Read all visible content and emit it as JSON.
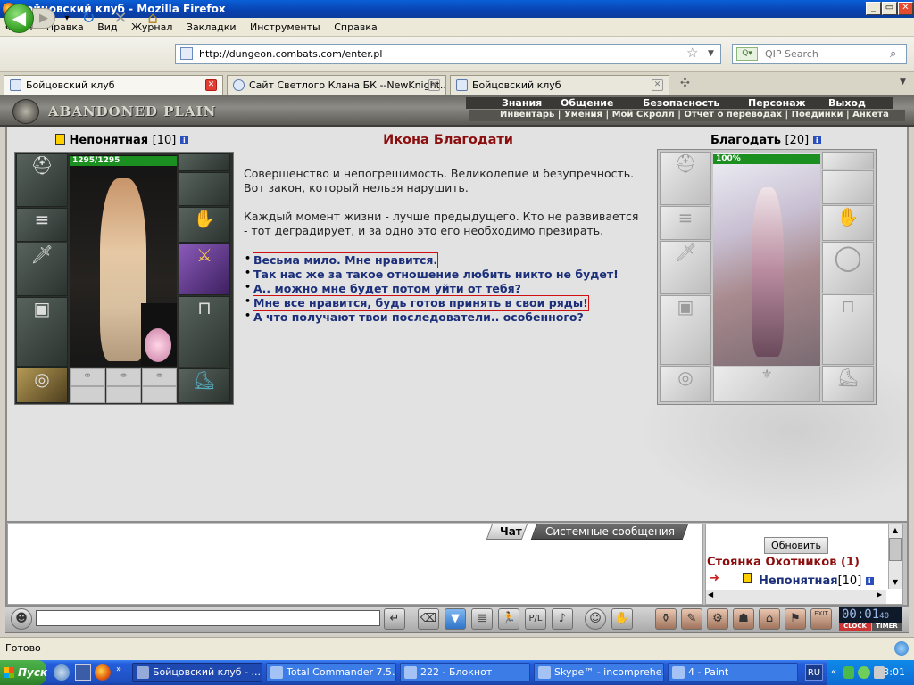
{
  "window": {
    "title": "Бойцовский клуб - Mozilla Firefox"
  },
  "menu": [
    "Файл",
    "Правка",
    "Вид",
    "Журнал",
    "Закладки",
    "Инструменты",
    "Справка"
  ],
  "toolbar": {
    "url": "http://dungeon.combats.com/enter.pl",
    "search_placeholder": "QIP Search"
  },
  "tabs": [
    {
      "label": "Бойцовский клуб",
      "active": true
    },
    {
      "label": "Сайт Светлого Клана БК --NewKnight...",
      "active": false
    },
    {
      "label": "Бойцовский клуб",
      "active": false
    }
  ],
  "game": {
    "location_logo": "ABANDONED PLAIN",
    "top_nav": [
      "Знания",
      "Общение",
      "Безопасность",
      "Персонаж",
      "Выход"
    ],
    "sub_nav": [
      "Инвентарь",
      "Умения",
      "Мой Скролл",
      "Отчет о переводах",
      "Поединки",
      "Анкета"
    ],
    "player": {
      "name": "Непонятная",
      "level": "[10]",
      "hp": "1295/1295"
    },
    "npc": {
      "name": "Благодать",
      "level": "[20]",
      "hp": "100%",
      "hp_fraction": 1.0
    },
    "dialog": {
      "title": "Икона Благодати",
      "para1_line1": "Совершенство и непогрешимость. Великолепие и безупречность.",
      "para1_line2": "Вот закон, который нельзя нарушить.",
      "para2_line1": "Каждый момент жизни - лучше предыдущего. Кто не развивается",
      "para2_line2": "- тот деградирует, и за одно это его необходимо презирать.",
      "options": [
        "Весьма мило. Мне нравится.",
        "Так нас же за такое отношение любить никто не будет!",
        "А.. можно мне будет потом уйти от тебя?",
        "Мне все нравится, будь готов принять в свои ряды!",
        "А что получают твои последователи.. особенного?"
      ]
    },
    "chat_tabs": [
      "Чат",
      "Системные сообщения"
    ],
    "side": {
      "refresh": "Обновить",
      "room": "Стоянка Охотников (1)",
      "member_name": "Непонятная",
      "member_level": "[10]"
    },
    "clock": {
      "time": "00:01",
      "seconds": "40",
      "clock_label": "CLOCK",
      "timer_label": "TIMER",
      "exit_label": "EXIT"
    }
  },
  "statusbar": {
    "text": "Готово"
  },
  "taskbar": {
    "start": "Пуск",
    "tasks": [
      "Бойцовский клуб - ...",
      "Total Commander 7.5...",
      "222 - Блокнот",
      "Skype™ - incomprehe...",
      "4 - Paint"
    ],
    "lang": "RU",
    "time": "23:01"
  },
  "colors": {
    "title_red": "#8b0d0d",
    "option_blue": "#1b2f7a",
    "highlight_red": "#d01010",
    "hp_green": "#1b8f1f"
  }
}
